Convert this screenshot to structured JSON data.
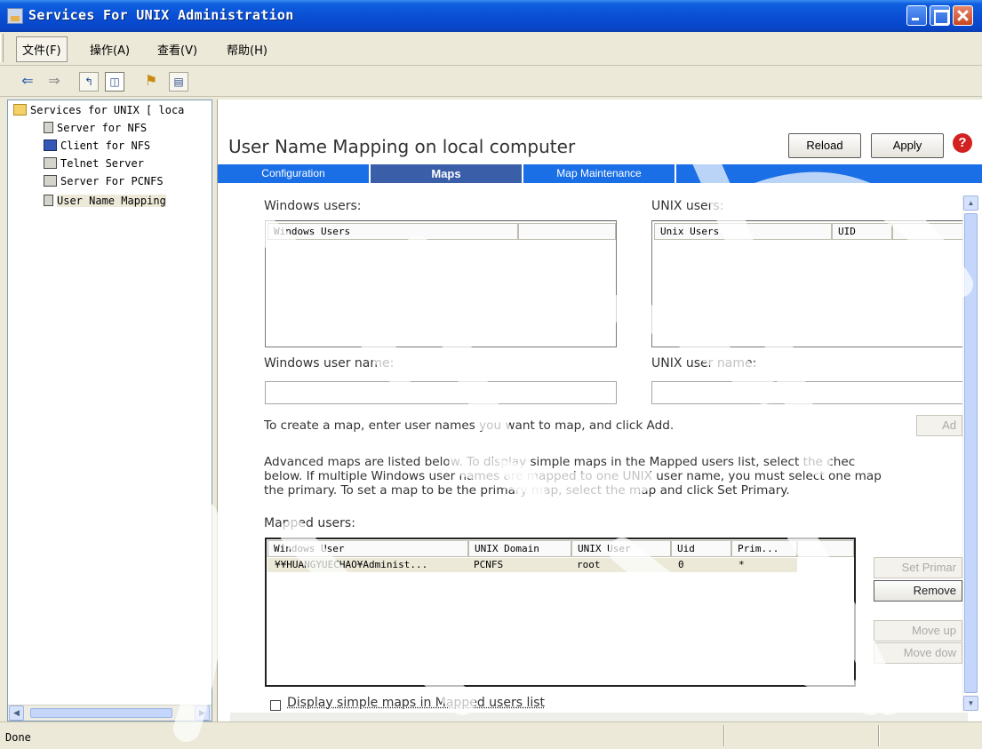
{
  "window": {
    "title": "Services For UNIX Administration"
  },
  "menu": [
    "文件(F)",
    "操作(A)",
    "查看(V)",
    "帮助(H)"
  ],
  "tree": {
    "root": "Services for UNIX [ loca",
    "items": [
      "Server for NFS",
      "Client for NFS",
      "Telnet Server",
      "Server For PCNFS",
      "User Name Mapping"
    ]
  },
  "content": {
    "title": "User Name Mapping on local computer",
    "reload_label": "Reload",
    "apply_label": "Apply",
    "tabs": [
      "Configuration",
      "Maps",
      "Map Maintenance"
    ],
    "windows_users_label": "Windows users:",
    "windows_users_header": "Windows Users",
    "unix_users_label": "UNIX users:",
    "unix_users_headers": [
      "Unix Users",
      "UID"
    ],
    "windows_user_name_label": "Windows user name:",
    "unix_user_name_label": "UNIX user name:",
    "create_map_text": "To create a map, enter user names you want to map, and click Add.",
    "add_label": "Ad",
    "advanced_text": [
      "Advanced maps are listed below. To display simple maps in the Mapped users list, select the chec",
      "below. If multiple Windows user names are mapped to one UNIX user name, you must select one map",
      "the primary. To set a map to be the primary map, select the map and click Set Primary."
    ],
    "mapped_users_label": "Mapped users:",
    "mapped_headers": [
      "Windows User",
      "UNIX Domain",
      "UNIX User",
      "Uid",
      "Prim..."
    ],
    "mapped_rows": [
      [
        "¥¥HUANGYUECHAO¥Administ...",
        "PCNFS",
        "root",
        "0",
        "*"
      ]
    ],
    "set_primary_label": "Set Primar",
    "remove_label": "Remove",
    "move_up_label": "Move up",
    "move_down_label": "Move dow",
    "display_simple_label": "Display simple maps in Mapped users list"
  },
  "status": {
    "text": "Done"
  }
}
